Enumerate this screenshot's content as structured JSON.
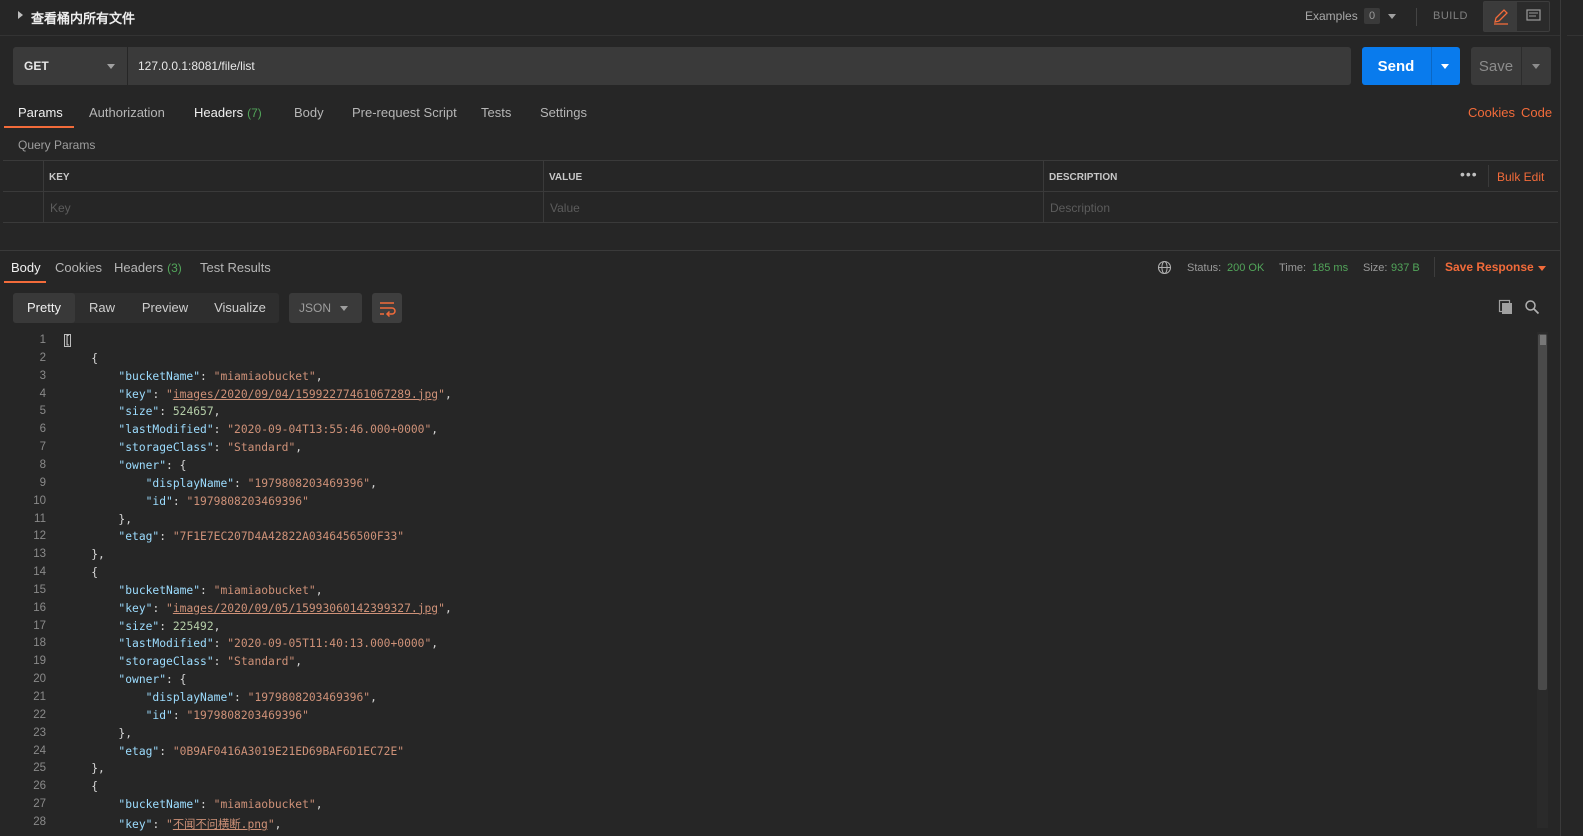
{
  "title": "查看桶内所有文件",
  "header": {
    "examples_label": "Examples",
    "examples_count": "0",
    "build_label": "BUILD"
  },
  "request": {
    "method": "GET",
    "url": "127.0.0.1:8081/file/list",
    "send_label": "Send",
    "save_label": "Save"
  },
  "request_tabs": [
    {
      "label": "Params",
      "count": ""
    },
    {
      "label": "Authorization",
      "count": ""
    },
    {
      "label": "Headers",
      "count": "(7)"
    },
    {
      "label": "Body",
      "count": ""
    },
    {
      "label": "Pre-request Script",
      "count": ""
    },
    {
      "label": "Tests",
      "count": ""
    },
    {
      "label": "Settings",
      "count": ""
    }
  ],
  "request_links": {
    "cookies": "Cookies",
    "code": "Code"
  },
  "query_params": {
    "label": "Query Params",
    "columns": [
      "KEY",
      "VALUE",
      "DESCRIPTION"
    ],
    "placeholders": [
      "Key",
      "Value",
      "Description"
    ],
    "more": "•••",
    "bulk_edit": "Bulk Edit"
  },
  "response_tabs": [
    {
      "label": "Body",
      "count": ""
    },
    {
      "label": "Cookies",
      "count": ""
    },
    {
      "label": "Headers",
      "count": "(3)"
    },
    {
      "label": "Test Results",
      "count": ""
    }
  ],
  "response_status": {
    "status_label": "Status:",
    "status_value": "200 OK",
    "time_label": "Time:",
    "time_value": "185 ms",
    "size_label": "Size:",
    "size_value": "937 B",
    "save_response": "Save Response"
  },
  "format_tabs": [
    "Pretty",
    "Raw",
    "Preview",
    "Visualize"
  ],
  "format_select": "JSON",
  "icons": {
    "globe": "globe-icon",
    "copy": "copy-icon",
    "search": "search-icon",
    "wrap": "wrap-lines-icon",
    "edit": "pencil-icon",
    "comment": "comment-icon"
  },
  "colors": {
    "accent": "#f26b3a",
    "send": "#097bed",
    "success": "#52a55a"
  },
  "code_lines": [
    [
      {
        "t": "p",
        "v": "["
      }
    ],
    [
      {
        "t": "p",
        "v": "    {"
      }
    ],
    [
      {
        "t": "p",
        "v": "        "
      },
      {
        "t": "k",
        "v": "\"bucketName\""
      },
      {
        "t": "p",
        "v": ": "
      },
      {
        "t": "s",
        "v": "\"miamiaobucket\""
      },
      {
        "t": "p",
        "v": ","
      }
    ],
    [
      {
        "t": "p",
        "v": "        "
      },
      {
        "t": "k",
        "v": "\"key\""
      },
      {
        "t": "p",
        "v": ": "
      },
      {
        "t": "s",
        "v": "\""
      },
      {
        "t": "su",
        "v": "images/2020/09/04/15992277461067289.jpg"
      },
      {
        "t": "s",
        "v": "\""
      },
      {
        "t": "p",
        "v": ","
      }
    ],
    [
      {
        "t": "p",
        "v": "        "
      },
      {
        "t": "k",
        "v": "\"size\""
      },
      {
        "t": "p",
        "v": ": "
      },
      {
        "t": "n",
        "v": "524657"
      },
      {
        "t": "p",
        "v": ","
      }
    ],
    [
      {
        "t": "p",
        "v": "        "
      },
      {
        "t": "k",
        "v": "\"lastModified\""
      },
      {
        "t": "p",
        "v": ": "
      },
      {
        "t": "s",
        "v": "\"2020-09-04T13:55:46.000+0000\""
      },
      {
        "t": "p",
        "v": ","
      }
    ],
    [
      {
        "t": "p",
        "v": "        "
      },
      {
        "t": "k",
        "v": "\"storageClass\""
      },
      {
        "t": "p",
        "v": ": "
      },
      {
        "t": "s",
        "v": "\"Standard\""
      },
      {
        "t": "p",
        "v": ","
      }
    ],
    [
      {
        "t": "p",
        "v": "        "
      },
      {
        "t": "k",
        "v": "\"owner\""
      },
      {
        "t": "p",
        "v": ": {"
      }
    ],
    [
      {
        "t": "p",
        "v": "            "
      },
      {
        "t": "k",
        "v": "\"displayName\""
      },
      {
        "t": "p",
        "v": ": "
      },
      {
        "t": "s",
        "v": "\"1979808203469396\""
      },
      {
        "t": "p",
        "v": ","
      }
    ],
    [
      {
        "t": "p",
        "v": "            "
      },
      {
        "t": "k",
        "v": "\"id\""
      },
      {
        "t": "p",
        "v": ": "
      },
      {
        "t": "s",
        "v": "\"1979808203469396\""
      }
    ],
    [
      {
        "t": "p",
        "v": "        },"
      }
    ],
    [
      {
        "t": "p",
        "v": "        "
      },
      {
        "t": "k",
        "v": "\"etag\""
      },
      {
        "t": "p",
        "v": ": "
      },
      {
        "t": "s",
        "v": "\"7F1E7EC207D4A42822A0346456500F33\""
      }
    ],
    [
      {
        "t": "p",
        "v": "    },"
      }
    ],
    [
      {
        "t": "p",
        "v": "    {"
      }
    ],
    [
      {
        "t": "p",
        "v": "        "
      },
      {
        "t": "k",
        "v": "\"bucketName\""
      },
      {
        "t": "p",
        "v": ": "
      },
      {
        "t": "s",
        "v": "\"miamiaobucket\""
      },
      {
        "t": "p",
        "v": ","
      }
    ],
    [
      {
        "t": "p",
        "v": "        "
      },
      {
        "t": "k",
        "v": "\"key\""
      },
      {
        "t": "p",
        "v": ": "
      },
      {
        "t": "s",
        "v": "\""
      },
      {
        "t": "su",
        "v": "images/2020/09/05/15993060142399327.jpg"
      },
      {
        "t": "s",
        "v": "\""
      },
      {
        "t": "p",
        "v": ","
      }
    ],
    [
      {
        "t": "p",
        "v": "        "
      },
      {
        "t": "k",
        "v": "\"size\""
      },
      {
        "t": "p",
        "v": ": "
      },
      {
        "t": "n",
        "v": "225492"
      },
      {
        "t": "p",
        "v": ","
      }
    ],
    [
      {
        "t": "p",
        "v": "        "
      },
      {
        "t": "k",
        "v": "\"lastModified\""
      },
      {
        "t": "p",
        "v": ": "
      },
      {
        "t": "s",
        "v": "\"2020-09-05T11:40:13.000+0000\""
      },
      {
        "t": "p",
        "v": ","
      }
    ],
    [
      {
        "t": "p",
        "v": "        "
      },
      {
        "t": "k",
        "v": "\"storageClass\""
      },
      {
        "t": "p",
        "v": ": "
      },
      {
        "t": "s",
        "v": "\"Standard\""
      },
      {
        "t": "p",
        "v": ","
      }
    ],
    [
      {
        "t": "p",
        "v": "        "
      },
      {
        "t": "k",
        "v": "\"owner\""
      },
      {
        "t": "p",
        "v": ": {"
      }
    ],
    [
      {
        "t": "p",
        "v": "            "
      },
      {
        "t": "k",
        "v": "\"displayName\""
      },
      {
        "t": "p",
        "v": ": "
      },
      {
        "t": "s",
        "v": "\"1979808203469396\""
      },
      {
        "t": "p",
        "v": ","
      }
    ],
    [
      {
        "t": "p",
        "v": "            "
      },
      {
        "t": "k",
        "v": "\"id\""
      },
      {
        "t": "p",
        "v": ": "
      },
      {
        "t": "s",
        "v": "\"1979808203469396\""
      }
    ],
    [
      {
        "t": "p",
        "v": "        },"
      }
    ],
    [
      {
        "t": "p",
        "v": "        "
      },
      {
        "t": "k",
        "v": "\"etag\""
      },
      {
        "t": "p",
        "v": ": "
      },
      {
        "t": "s",
        "v": "\"0B9AF0416A3019E21ED69BAF6D1EC72E\""
      }
    ],
    [
      {
        "t": "p",
        "v": "    },"
      }
    ],
    [
      {
        "t": "p",
        "v": "    {"
      }
    ],
    [
      {
        "t": "p",
        "v": "        "
      },
      {
        "t": "k",
        "v": "\"bucketName\""
      },
      {
        "t": "p",
        "v": ": "
      },
      {
        "t": "s",
        "v": "\"miamiaobucket\""
      },
      {
        "t": "p",
        "v": ","
      }
    ],
    [
      {
        "t": "p",
        "v": "        "
      },
      {
        "t": "k",
        "v": "\"key\""
      },
      {
        "t": "p",
        "v": ": "
      },
      {
        "t": "s",
        "v": "\""
      },
      {
        "t": "su",
        "v": "不闻不问横断.png"
      },
      {
        "t": "s",
        "v": "\""
      },
      {
        "t": "p",
        "v": ","
      }
    ]
  ]
}
